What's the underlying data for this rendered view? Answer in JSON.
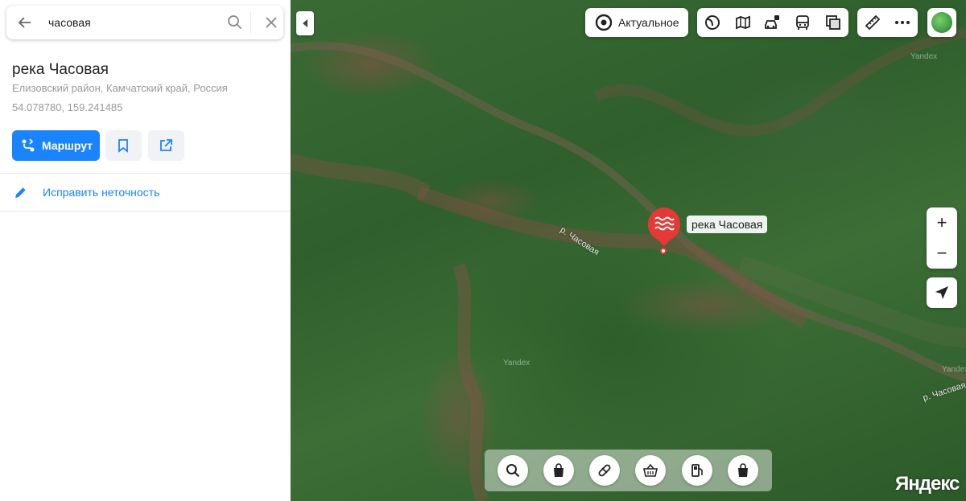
{
  "search": {
    "query": "часовая"
  },
  "place": {
    "title": "река Часовая",
    "subtitle": "Елизовский район, Камчатский край, Россия",
    "coords": "54.078780, 159.241485"
  },
  "actions": {
    "route_label": "Маршрут",
    "fix_label": "Исправить неточность"
  },
  "map": {
    "layers": {
      "actual_label": "Актуальное"
    },
    "zoom": {
      "in": "+",
      "out": "−"
    },
    "marker_label": "река Часовая",
    "river_labels": [
      "р. Часовая",
      "р. Часовая"
    ],
    "watermark": "Yandex",
    "brand": "Яндекс"
  },
  "colors": {
    "accent": "#1a84ff",
    "marker": "#e53935"
  },
  "icons": {
    "categories": [
      "search-icon",
      "shopping-bag-icon",
      "pharmacy-icon",
      "grocery-basket-icon",
      "gas-station-icon",
      "shopping-bag-icon"
    ]
  }
}
